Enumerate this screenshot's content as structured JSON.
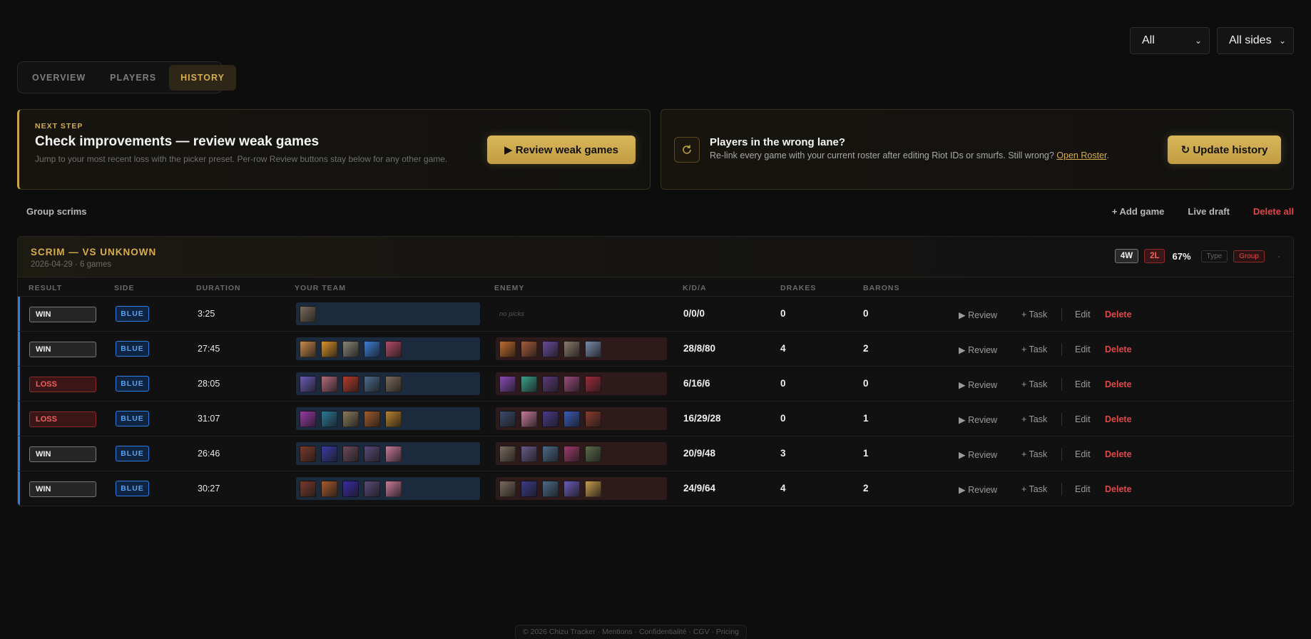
{
  "filters": {
    "period": "All",
    "sides": "All sides"
  },
  "tabs": [
    "OVERVIEW",
    "PLAYERS",
    "HISTORY"
  ],
  "next_step": {
    "label": "NEXT STEP",
    "title": "Check improvements — review weak games",
    "desc": "Jump to your most recent loss with the picker preset. Per-row Review buttons stay below for any other game.",
    "button": "▶ Review weak games"
  },
  "lane_card": {
    "title": "Players in the wrong lane?",
    "desc": "Re-link every game with your current roster after editing Riot IDs or smurfs. Still wrong?",
    "link": "Open Roster",
    "button": "↻ Update history"
  },
  "actionbar": {
    "group": "Group scrims",
    "add": "+ Add game",
    "live": "Live draft",
    "delete_all": "Delete all"
  },
  "scrim": {
    "title": "SCRIM — VS UNKNOWN",
    "meta": "2026-04-29 · 6 games",
    "wins": "4W",
    "losses": "2L",
    "winrate": "67%",
    "type_tag": "Type",
    "group_tag": "Group",
    "dot": "·"
  },
  "columns": [
    "RESULT",
    "SIDE",
    "DURATION",
    "YOUR TEAM",
    "ENEMY",
    "K/D/A",
    "DRAKES",
    "BARONS"
  ],
  "row_actions": {
    "review": "▶ Review",
    "task": "+ Task",
    "edit": "Edit",
    "delete": "Delete"
  },
  "no_picks": "no picks",
  "games": [
    {
      "result": "WIN",
      "side": "BLUE",
      "duration": "3:25",
      "kda": "0/0/0",
      "drakes": "0",
      "barons": "0",
      "team": [
        "#7a6a5a"
      ],
      "enemy": []
    },
    {
      "result": "WIN",
      "side": "BLUE",
      "duration": "27:45",
      "kda": "28/8/80",
      "drakes": "4",
      "barons": "2",
      "team": [
        "#c8894a",
        "#d9922a",
        "#8a8478",
        "#3a7ed8",
        "#b44a6a"
      ],
      "enemy": [
        "#c46a2a",
        "#a85a3a",
        "#6a4a9a",
        "#8a7a6a",
        "#7a8aaa"
      ]
    },
    {
      "result": "LOSS",
      "side": "BLUE",
      "duration": "28:05",
      "kda": "6/16/6",
      "drakes": "0",
      "barons": "0",
      "team": [
        "#6a5ab8",
        "#b46a7a",
        "#b83a2a",
        "#4a6a8a",
        "#7a6a5a"
      ],
      "enemy": [
        "#8a4ab8",
        "#3aa08a",
        "#5a3a7a",
        "#9a4a7a",
        "#a02a3a"
      ]
    },
    {
      "result": "LOSS",
      "side": "BLUE",
      "duration": "31:07",
      "kda": "16/29/28",
      "drakes": "0",
      "barons": "1",
      "team": [
        "#9a3aa8",
        "#2a7a9a",
        "#8a7a5a",
        "#a05a2a",
        "#b8822a"
      ],
      "enemy": [
        "#3a4a6a",
        "#c87a9a",
        "#4a3a8a",
        "#3a5ab8",
        "#8a3a2a"
      ]
    },
    {
      "result": "WIN",
      "side": "BLUE",
      "duration": "26:46",
      "kda": "20/9/48",
      "drakes": "3",
      "barons": "1",
      "team": [
        "#7a3a2a",
        "#3a3aa8",
        "#6a4a5a",
        "#5a4a7a",
        "#c87a9a"
      ],
      "enemy": [
        "#7a6a5a",
        "#6a5a8a",
        "#4a6a8a",
        "#a03a6a",
        "#5a6a4a"
      ]
    },
    {
      "result": "WIN",
      "side": "BLUE",
      "duration": "30:27",
      "kda": "24/9/64",
      "drakes": "4",
      "barons": "2",
      "team": [
        "#7a3a2a",
        "#a85a2a",
        "#3a2aa8",
        "#5a4a7a",
        "#c87a9a"
      ],
      "enemy": [
        "#7a6a5a",
        "#3a3a8a",
        "#4a6a8a",
        "#6a5ab8",
        "#c89a4a"
      ]
    }
  ],
  "footer": "© 2026 Chizu Tracker · Mentions · Confidentialité · CGV · Pricing"
}
